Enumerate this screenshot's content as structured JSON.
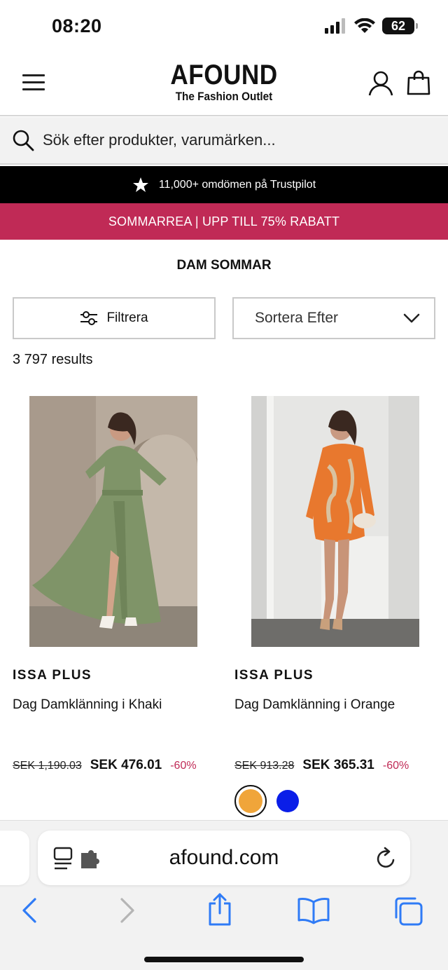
{
  "status": {
    "time": "08:20",
    "battery": "62"
  },
  "header": {
    "logo_main": "AFOUND",
    "logo_sub": "The Fashion Outlet"
  },
  "search": {
    "placeholder": "Sök efter produkter, varumärken..."
  },
  "trust_bar": {
    "text": "11,000+ omdömen på Trustpilot"
  },
  "promo_bar": {
    "text": "SOMMARREA | UPP TILL 75% RABATT"
  },
  "page_title": "DAM SOMMAR",
  "controls": {
    "filter_label": "Filtrera",
    "sort_label": "Sortera Efter"
  },
  "results_text": "3 797 results",
  "products": [
    {
      "brand": "ISSA PLUS",
      "title": "Dag Damklänning i Khaki",
      "old_price": "SEK 1,190.03",
      "price": "SEK 476.01",
      "discount": "-60%",
      "color": "#7f9468"
    },
    {
      "brand": "ISSA PLUS",
      "title": "Dag Damklänning i Orange",
      "old_price": "SEK 913.28",
      "price": "SEK 365.31",
      "discount": "-60%",
      "color": "#e8782e"
    }
  ],
  "swatches": [
    {
      "color": "#f0a53a",
      "selected": true
    },
    {
      "color": "#0a1ee8",
      "selected": false
    }
  ],
  "browser": {
    "url": "afound.com"
  },
  "colors": {
    "promo": "#c02a56",
    "trust": "#000000",
    "ios_blue": "#2f7bf6"
  }
}
